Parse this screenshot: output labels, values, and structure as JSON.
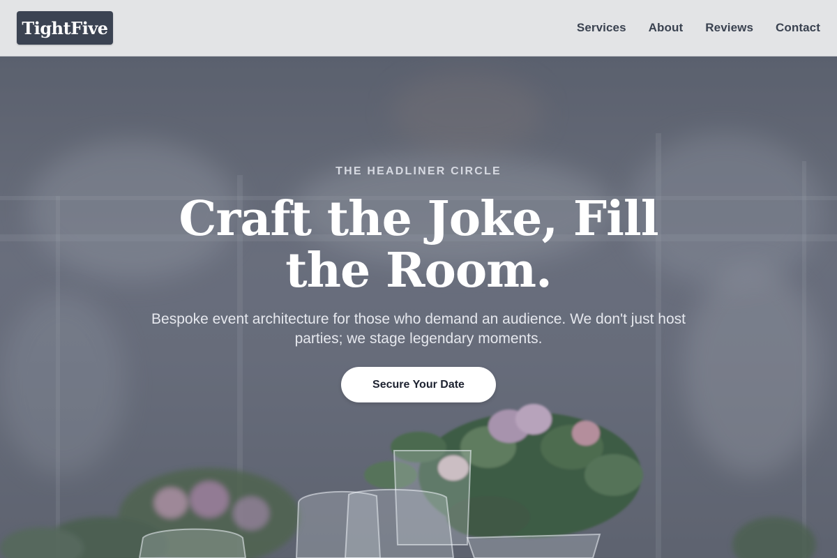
{
  "brand": {
    "name": "TightFive"
  },
  "nav": {
    "items": [
      {
        "label": "Services"
      },
      {
        "label": "About"
      },
      {
        "label": "Reviews"
      },
      {
        "label": "Contact"
      }
    ]
  },
  "hero": {
    "eyebrow": "THE HEADLINER CIRCLE",
    "headline": "Craft the Joke, Fill the Room.",
    "subtext": "Bespoke event architecture for those who demand an audience. We don't just host parties; we stage legendary moments.",
    "cta_label": "Secure Your Date"
  },
  "colors": {
    "header_bg": "#e3e4e6",
    "logo_bg": "#3b4352",
    "nav_text": "#3a4250",
    "hero_overlay": "#5b6270",
    "cta_bg": "#ffffff",
    "cta_text": "#1d2230"
  }
}
